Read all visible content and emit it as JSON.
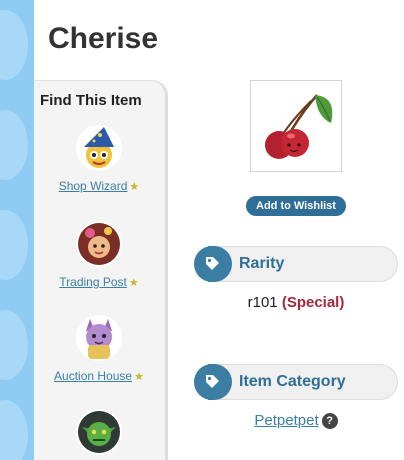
{
  "item": {
    "name": "Cherise",
    "wishlist_label": "Add to Wishlist"
  },
  "find_panel": {
    "title": "Find This Item",
    "links": [
      {
        "label": "Shop Wizard",
        "starred": true
      },
      {
        "label": "Trading Post",
        "starred": true
      },
      {
        "label": "Auction House",
        "starred": true
      }
    ],
    "star_glyph": "★"
  },
  "rarity": {
    "header": "Rarity",
    "code": "r101",
    "tier": "(Special)"
  },
  "category": {
    "header": "Item Category",
    "value": "Petpetpet",
    "help_glyph": "?"
  },
  "colors": {
    "accent_blue": "#2f6f97",
    "link_blue": "#3a7fa6",
    "special_red": "#a3283e",
    "star_gold": "#c9b72c"
  }
}
